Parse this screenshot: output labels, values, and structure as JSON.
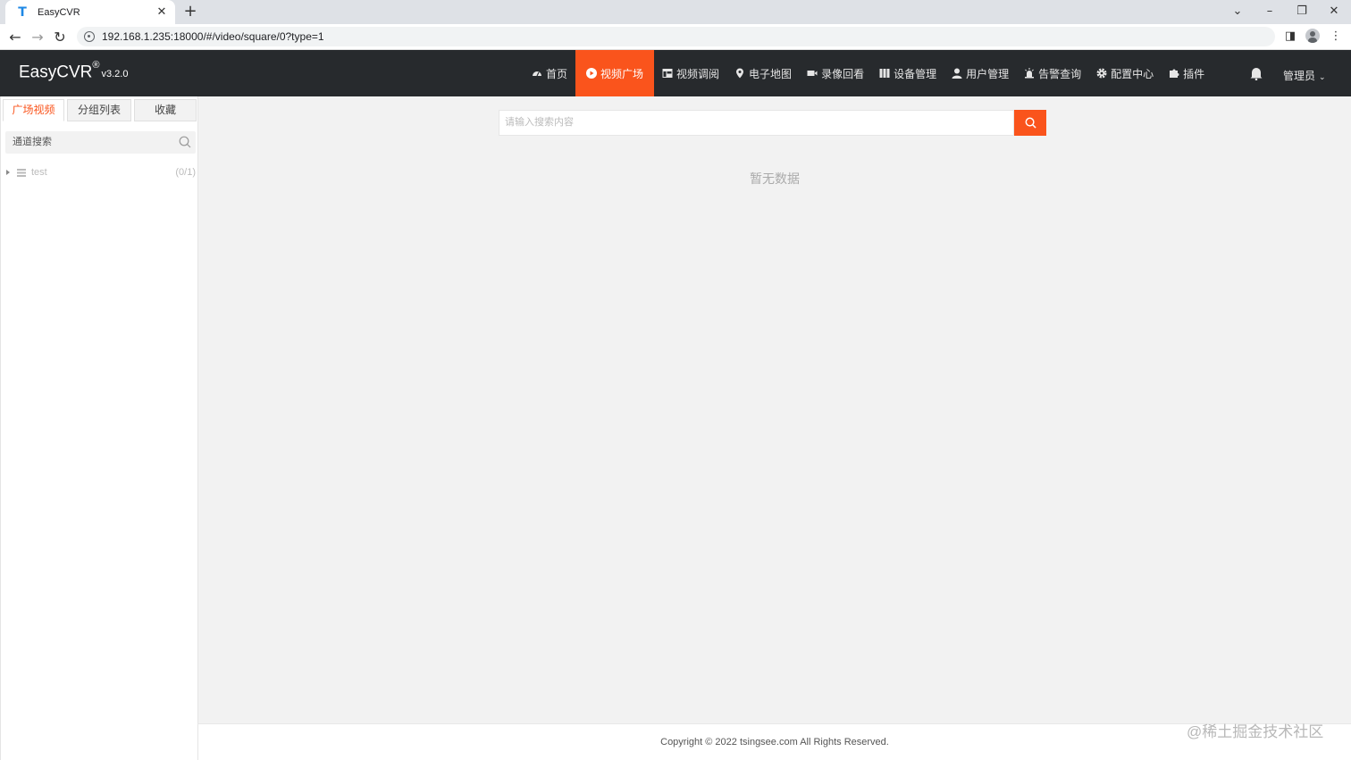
{
  "browser": {
    "tab_title": "EasyCVR",
    "favicon_glyph": "T",
    "url": "192.168.1.235:18000/#/video/square/0?type=1"
  },
  "app": {
    "brand": "EasyCVR",
    "brand_mark": "®",
    "version": "v3.2.0",
    "accent_color": "#fa541c",
    "header_bg": "#272a2d"
  },
  "nav": [
    {
      "label": "首页",
      "icon": "dashboard-icon",
      "active": false
    },
    {
      "label": "视频广场",
      "icon": "play-circle-icon",
      "active": true
    },
    {
      "label": "视频调阅",
      "icon": "layout-icon",
      "active": false
    },
    {
      "label": "电子地图",
      "icon": "map-marker-icon",
      "active": false
    },
    {
      "label": "录像回看",
      "icon": "video-camera-icon",
      "active": false
    },
    {
      "label": "设备管理",
      "icon": "columns-icon",
      "active": false
    },
    {
      "label": "用户管理",
      "icon": "user-icon",
      "active": false
    },
    {
      "label": "告警查询",
      "icon": "alarm-icon",
      "active": false
    },
    {
      "label": "配置中心",
      "icon": "gear-icon",
      "active": false
    },
    {
      "label": "插件",
      "icon": "puzzle-icon",
      "active": false
    }
  ],
  "user_menu": {
    "label": "管理员"
  },
  "sidebar": {
    "tabs": [
      "广场视频",
      "分组列表",
      "收藏"
    ],
    "search_placeholder": "通道搜索",
    "tree": [
      {
        "label": "test",
        "count": "(0/1)"
      }
    ]
  },
  "main": {
    "search_placeholder": "请输入搜索内容",
    "empty_text": "暂无数据"
  },
  "footer": {
    "copyright": "Copyright © 2022 tsingsee.com All Rights Reserved."
  },
  "watermark": "@稀土掘金技术社区"
}
